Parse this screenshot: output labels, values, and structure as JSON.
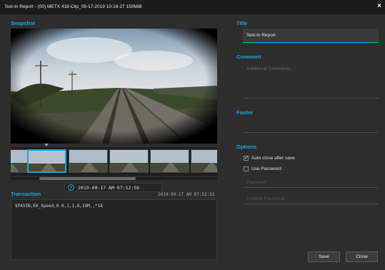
{
  "window": {
    "title": "Text-In Report - (00) METX 418-Clip_09-17-2019 10-16-27 150MiB",
    "close_glyph": "×"
  },
  "snapshot": {
    "label": "Snapshot",
    "thumbnail_count": 6,
    "selected_thumbnail": 2
  },
  "transaction": {
    "label": "Transaction",
    "selected_time": "2019-09-17 AM 07:52:56",
    "timestamp": "2019-09-17 AM 07:52:53",
    "text": "$PAVIN,EH_Speed,0.0,1,1,0,10M,,*18"
  },
  "form": {
    "title_label": "Title",
    "title_value": "Text-In Report",
    "comment_label": "Comment",
    "comment_placeholder": "Additional Comments...",
    "footer_label": "Footer",
    "options_label": "Options",
    "auto_close_label": "Auto close after save",
    "auto_close_checked": true,
    "use_password_label": "Use Password",
    "use_password_checked": false,
    "password_placeholder": "Password",
    "confirm_password_placeholder": "Confirm Password"
  },
  "buttons": {
    "save": "Save",
    "close": "Close"
  },
  "colors": {
    "accent": "#1aa5d6",
    "background": "#2d2d2d",
    "titlebar": "#1c1c1c"
  },
  "icons": [
    "close-icon",
    "clock-icon",
    "checkbox-icon"
  ]
}
